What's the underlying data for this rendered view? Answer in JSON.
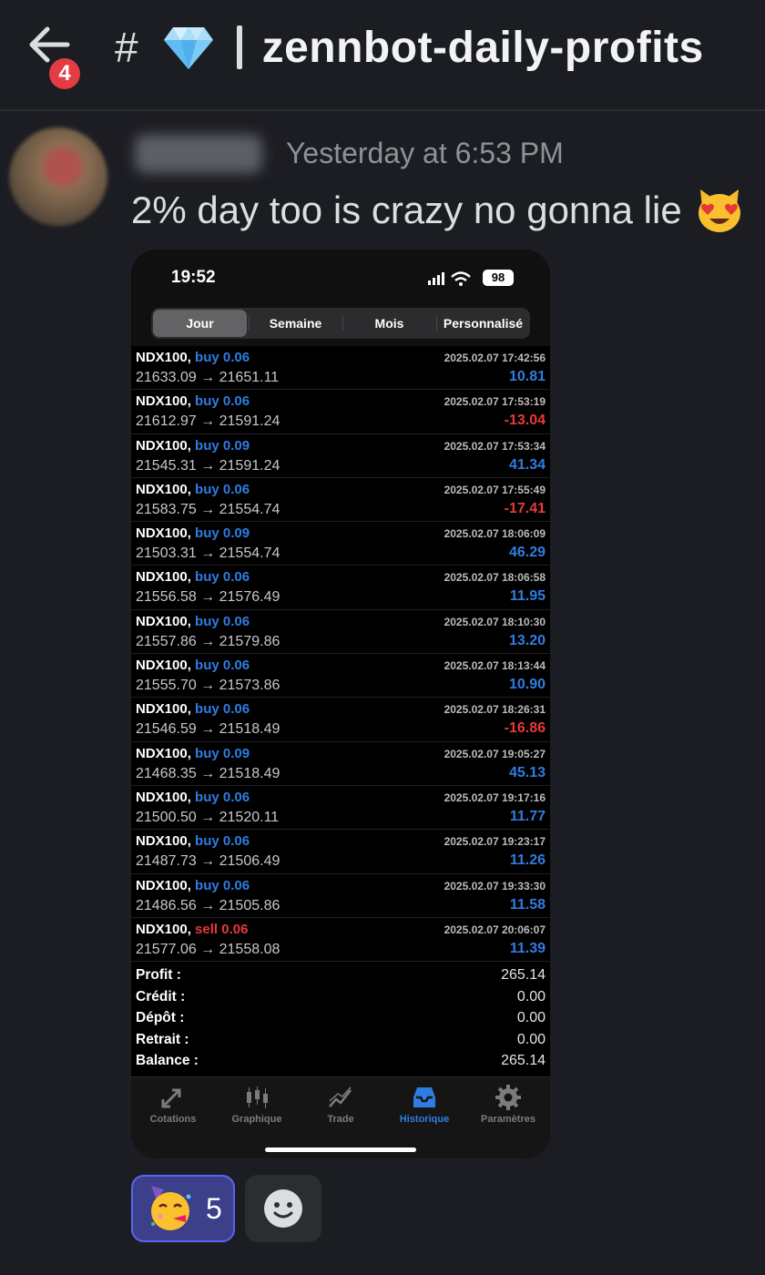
{
  "header": {
    "back_badge": "4",
    "hash": "#",
    "channel_name": "zennbot-daily-profits"
  },
  "message": {
    "timestamp": "Yesterday at 6:53 PM",
    "text": "2% day too is crazy no gonna lie"
  },
  "phone": {
    "clock": "19:52",
    "battery": "98",
    "segments": [
      "Jour",
      "Semaine",
      "Mois",
      "Personnalisé"
    ],
    "trades": [
      {
        "symbol": "NDX100,",
        "side": "buy 0.06",
        "dir": "buy",
        "prices": "21633.09 → 21651.11",
        "datetime": "2025.02.07 17:42:56",
        "profit": "10.81"
      },
      {
        "symbol": "NDX100,",
        "side": "buy 0.06",
        "dir": "buy",
        "prices": "21612.97 → 21591.24",
        "datetime": "2025.02.07 17:53:19",
        "profit": "-13.04"
      },
      {
        "symbol": "NDX100,",
        "side": "buy 0.09",
        "dir": "buy",
        "prices": "21545.31 → 21591.24",
        "datetime": "2025.02.07 17:53:34",
        "profit": "41.34"
      },
      {
        "symbol": "NDX100,",
        "side": "buy 0.06",
        "dir": "buy",
        "prices": "21583.75 → 21554.74",
        "datetime": "2025.02.07 17:55:49",
        "profit": "-17.41"
      },
      {
        "symbol": "NDX100,",
        "side": "buy 0.09",
        "dir": "buy",
        "prices": "21503.31 → 21554.74",
        "datetime": "2025.02.07 18:06:09",
        "profit": "46.29"
      },
      {
        "symbol": "NDX100,",
        "side": "buy 0.06",
        "dir": "buy",
        "prices": "21556.58 → 21576.49",
        "datetime": "2025.02.07 18:06:58",
        "profit": "11.95"
      },
      {
        "symbol": "NDX100,",
        "side": "buy 0.06",
        "dir": "buy",
        "prices": "21557.86 → 21579.86",
        "datetime": "2025.02.07 18:10:30",
        "profit": "13.20"
      },
      {
        "symbol": "NDX100,",
        "side": "buy 0.06",
        "dir": "buy",
        "prices": "21555.70 → 21573.86",
        "datetime": "2025.02.07 18:13:44",
        "profit": "10.90"
      },
      {
        "symbol": "NDX100,",
        "side": "buy 0.06",
        "dir": "buy",
        "prices": "21546.59 → 21518.49",
        "datetime": "2025.02.07 18:26:31",
        "profit": "-16.86"
      },
      {
        "symbol": "NDX100,",
        "side": "buy 0.09",
        "dir": "buy",
        "prices": "21468.35 → 21518.49",
        "datetime": "2025.02.07 19:05:27",
        "profit": "45.13"
      },
      {
        "symbol": "NDX100,",
        "side": "buy 0.06",
        "dir": "buy",
        "prices": "21500.50 → 21520.11",
        "datetime": "2025.02.07 19:17:16",
        "profit": "11.77"
      },
      {
        "symbol": "NDX100,",
        "side": "buy 0.06",
        "dir": "buy",
        "prices": "21487.73 → 21506.49",
        "datetime": "2025.02.07 19:23:17",
        "profit": "11.26"
      },
      {
        "symbol": "NDX100,",
        "side": "buy 0.06",
        "dir": "buy",
        "prices": "21486.56 → 21505.86",
        "datetime": "2025.02.07 19:33:30",
        "profit": "11.58"
      },
      {
        "symbol": "NDX100,",
        "side": "sell 0.06",
        "dir": "sell",
        "prices": "21577.06 → 21558.08",
        "datetime": "2025.02.07 20:06:07",
        "profit": "11.39"
      }
    ],
    "summary": [
      {
        "label": "Profit :",
        "value": "265.14"
      },
      {
        "label": "Crédit :",
        "value": "0.00"
      },
      {
        "label": "Dépôt :",
        "value": "0.00"
      },
      {
        "label": "Retrait :",
        "value": "0.00"
      },
      {
        "label": "Balance :",
        "value": "265.14"
      }
    ],
    "tabs": [
      {
        "label": "Cotations",
        "icon": "quotes-arrows-icon"
      },
      {
        "label": "Graphique",
        "icon": "candlestick-chart-icon"
      },
      {
        "label": "Trade",
        "icon": "trade-chart-icon"
      },
      {
        "label": "Historique",
        "icon": "history-inbox-icon"
      },
      {
        "label": "Paramètres",
        "icon": "settings-gear-icon"
      }
    ],
    "active_tab": "Historique"
  },
  "reactions": [
    {
      "emoji": "partying-face-icon",
      "count": "5",
      "active": true
    }
  ],
  "colors": {
    "background": "#1c1d22",
    "buy_blue": "#2f7de1",
    "sell_red": "#e8393a",
    "reaction_active": "#3c3f8a"
  }
}
